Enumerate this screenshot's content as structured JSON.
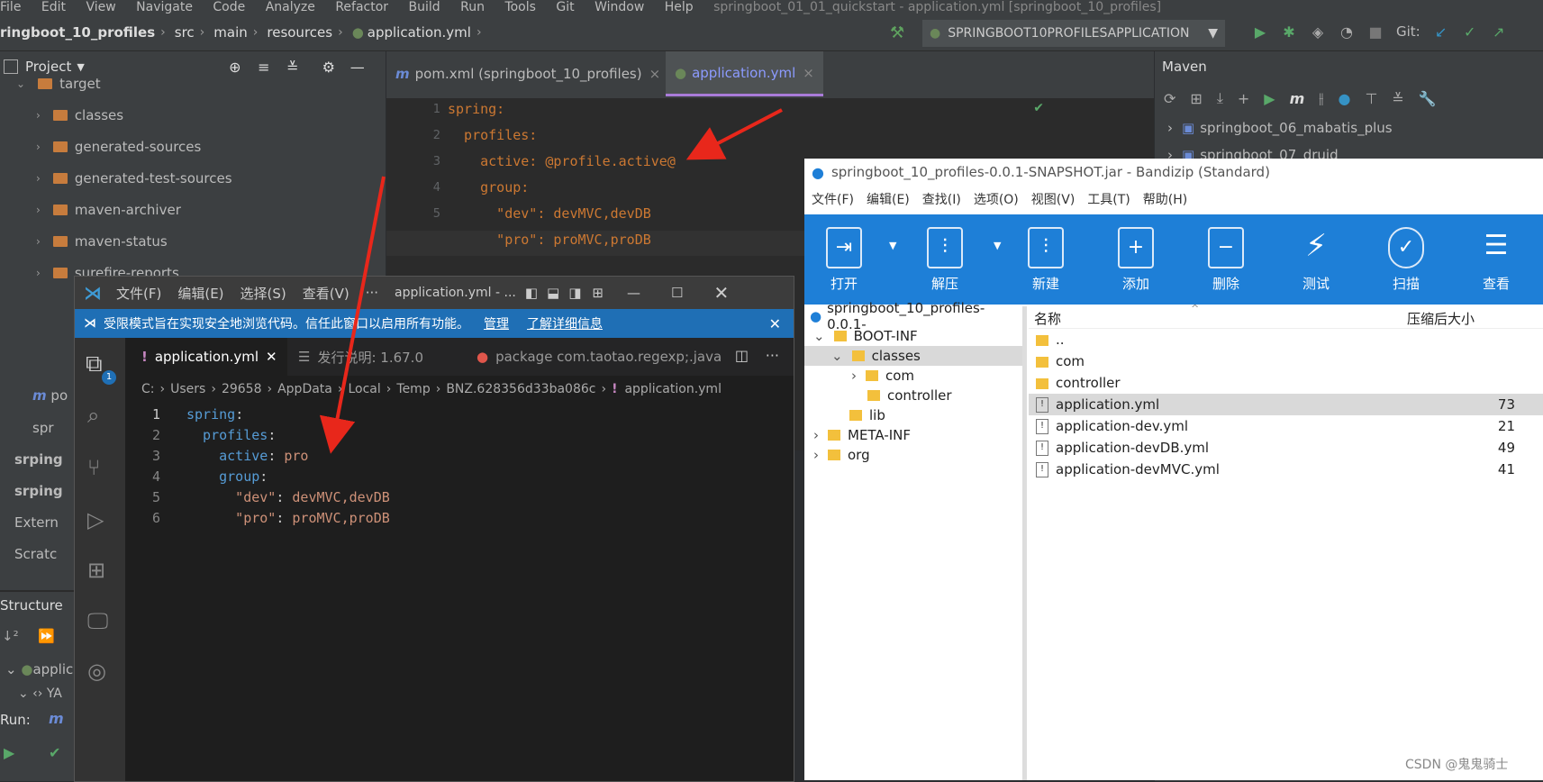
{
  "ij": {
    "menu": [
      "File",
      "Edit",
      "View",
      "Navigate",
      "Code",
      "Analyze",
      "Refactor",
      "Build",
      "Run",
      "Tools",
      "Git",
      "Window",
      "Help"
    ],
    "menu_title": "springboot_01_01_quickstart - application.yml [springboot_10_profiles]",
    "breadcrumb": [
      "ringboot_10_profiles",
      "src",
      "main",
      "resources",
      "application.yml"
    ],
    "run_config": "SPRINGBOOT10PROFILESAPPLICATION",
    "git_label": "Git:",
    "project_title": "Project",
    "tree": [
      "target",
      "classes",
      "generated-sources",
      "generated-test-sources",
      "maven-archiver",
      "maven-status",
      "surefire-reports"
    ],
    "side_items": [
      "po",
      "spr",
      "srping",
      "srping",
      "Extern",
      "Scratc"
    ],
    "structure_label": "Structure",
    "run_label": "Run:",
    "struct_items": [
      "applic",
      "YA"
    ],
    "tabs": [
      "pom.xml (springboot_10_profiles)",
      "application.yml"
    ],
    "code": [
      {
        "n": "1",
        "t": "spring:"
      },
      {
        "n": "2",
        "t": "  profiles:"
      },
      {
        "n": "3",
        "t": "    active: @profile.active@"
      },
      {
        "n": "4",
        "t": "    group:"
      },
      {
        "n": "5",
        "t": "      \"dev\": devMVC,devDB"
      },
      {
        "n": "6",
        "t": "      \"pro\": proMVC,proDB"
      }
    ],
    "maven_title": "Maven",
    "maven_items": [
      "springboot_06_mabatis_plus",
      "springboot_07_druid"
    ]
  },
  "vsc": {
    "menu": [
      "文件(F)",
      "编辑(E)",
      "选择(S)",
      "查看(V)",
      "···"
    ],
    "title": "application.yml - ...",
    "banner": "受限模式旨在实现安全地浏览代码。信任此窗口以启用所有功能。",
    "banner_manage": "管理",
    "banner_more": "了解详细信息",
    "tabs": [
      "application.yml",
      "发行说明: 1.67.0",
      "package com.taotao.regexp;.java"
    ],
    "breadcrumb": [
      "C:",
      "Users",
      "29658",
      "AppData",
      "Local",
      "Temp",
      "BNZ.628356d33ba086c",
      "application.yml"
    ],
    "badge": "1",
    "lines": [
      {
        "n": "1",
        "k": "spring",
        "v": ""
      },
      {
        "n": "2",
        "k": "  profiles",
        "v": ""
      },
      {
        "n": "3",
        "k": "    active",
        "v": "pro"
      },
      {
        "n": "4",
        "k": "    group",
        "v": ""
      },
      {
        "n": "5",
        "k": "      \"dev\"",
        "v": "devMVC,devDB"
      },
      {
        "n": "6",
        "k": "      \"pro\"",
        "v": "proMVC,proDB"
      }
    ]
  },
  "bz": {
    "title": "springboot_10_profiles-0.0.1-SNAPSHOT.jar - Bandizip (Standard)",
    "menu": [
      "文件(F)",
      "编辑(E)",
      "查找(I)",
      "选项(O)",
      "视图(V)",
      "工具(T)",
      "帮助(H)"
    ],
    "tools": [
      "打开",
      "解压",
      "新建",
      "添加",
      "删除",
      "测试",
      "扫描",
      "查看"
    ],
    "tree": [
      "springboot_10_profiles-0.0.1-",
      "BOOT-INF",
      "classes",
      "com",
      "controller",
      "lib",
      "META-INF",
      "org"
    ],
    "col_name": "名称",
    "col_size": "压缩后大小",
    "files": [
      {
        "name": "..",
        "size": ""
      },
      {
        "name": "com",
        "size": ""
      },
      {
        "name": "controller",
        "size": ""
      },
      {
        "name": "application.yml",
        "size": "73"
      },
      {
        "name": "application-dev.yml",
        "size": "21"
      },
      {
        "name": "application-devDB.yml",
        "size": "49"
      },
      {
        "name": "application-devMVC.yml",
        "size": "41"
      }
    ]
  },
  "watermark": "CSDN @鬼鬼骑士",
  "colors": {
    "arrow": "#e8271b",
    "bz_blue": "#1e7fd7",
    "vsc_banner": "#1f6fb5"
  }
}
